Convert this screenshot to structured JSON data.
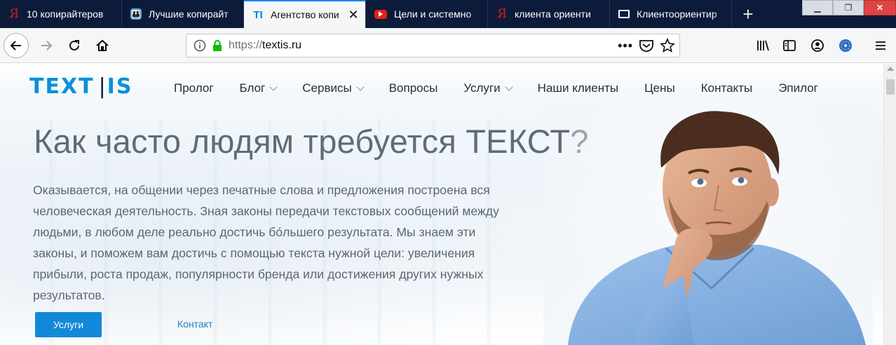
{
  "browser": {
    "tabs": [
      {
        "label": "10 копирайтеров",
        "icon": "yandex-icon",
        "active": false
      },
      {
        "label": "Лучшие копирайт",
        "icon": "people-icon",
        "active": false
      },
      {
        "label": "Агентство копи",
        "icon": "textis-icon",
        "active": true
      },
      {
        "label": "Цели и системно",
        "icon": "youtube-icon",
        "active": false
      },
      {
        "label": "клиента ориенти",
        "icon": "yandex-icon",
        "active": false
      },
      {
        "label": "Клиентоориентир",
        "icon": "monitor-icon",
        "active": false
      }
    ],
    "favicon_glyphs": {
      "yandex": "Я",
      "people": "👪",
      "textis": "TI"
    },
    "new_tab_glyph": "+",
    "url_prefix": "https://",
    "url_host": "textis.ru",
    "accent": "#0a84ff",
    "tabstrip_color": "#0c1b3a"
  },
  "site": {
    "logo_text": "TEXT",
    "logo_bar": "IS",
    "brand_color": "#0a90d8",
    "menu": [
      {
        "label": "Пролог",
        "dropdown": false
      },
      {
        "label": "Блог",
        "dropdown": true
      },
      {
        "label": "Сервисы",
        "dropdown": true
      },
      {
        "label": "Вопросы",
        "dropdown": false
      },
      {
        "label": "Услуги",
        "dropdown": true
      },
      {
        "label": "Наши клиенты",
        "dropdown": false
      },
      {
        "label": "Цены",
        "dropdown": false
      },
      {
        "label": "Контакты",
        "dropdown": false
      },
      {
        "label": "Эпилог",
        "dropdown": false
      }
    ],
    "hero": {
      "headline": "Как часто людям требуется ТЕКСТ",
      "headline_mark": "?",
      "lead": "Оказывается, на общении через печатные слова и предложения построена вся человеческая деятельность. Зная законы передачи текстовых сообщений между людьми, в любом деле реально достичь бо́льшего результата. Мы знаем эти законы, и поможем вам достичь с помощью текста нужной цели: увеличения прибыли, роста продаж, популярности бренда или достижения других нужных результатов.",
      "primary_button": "Услуги",
      "secondary_link": "Контакт",
      "button_color": "#1289d8"
    }
  }
}
